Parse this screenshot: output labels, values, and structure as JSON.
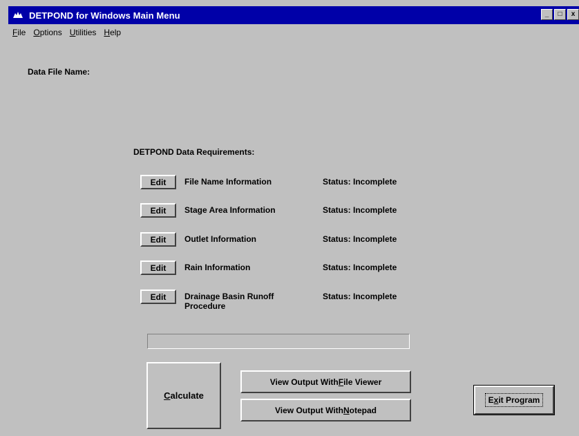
{
  "window": {
    "title": "DETPOND for Windows Main Menu",
    "controls": {
      "minimize": "_",
      "maximize": "□",
      "close": "x"
    }
  },
  "menu": [
    {
      "pre": "",
      "u": "F",
      "post": "ile"
    },
    {
      "pre": "",
      "u": "O",
      "post": "ptions"
    },
    {
      "pre": "",
      "u": "U",
      "post": "tilities"
    },
    {
      "pre": "",
      "u": "H",
      "post": "elp"
    }
  ],
  "data_file_label": "Data File Name:",
  "requirements_heading": "DETPOND Data Requirements:",
  "requirements": [
    {
      "button": "Edit",
      "label": "File Name Information",
      "status": "Status:  Incomplete"
    },
    {
      "button": "Edit",
      "label": "Stage Area Information",
      "status": "Status:  Incomplete"
    },
    {
      "button": "Edit",
      "label": "Outlet Information",
      "status": "Status:  Incomplete"
    },
    {
      "button": "Edit",
      "label": "Rain Information",
      "status": "Status:  Incomplete"
    },
    {
      "button": "Edit",
      "label": "Drainage Basin Runoff Procedure",
      "status": "Status:  Incomplete"
    }
  ],
  "progress": {
    "fraction": 0
  },
  "buttons": {
    "calculate": {
      "pre": "",
      "u": "C",
      "post": "alculate"
    },
    "view_file_viewer": {
      "pre": "View Output With ",
      "u": "F",
      "post": "ile Viewer"
    },
    "view_notepad": {
      "pre": "View Output With ",
      "u": "N",
      "post": "otepad"
    },
    "exit": {
      "pre": "E",
      "u": "x",
      "post": "it Program"
    }
  },
  "colors": {
    "titlebar": "#0000a8",
    "face": "#c0c0c0"
  }
}
